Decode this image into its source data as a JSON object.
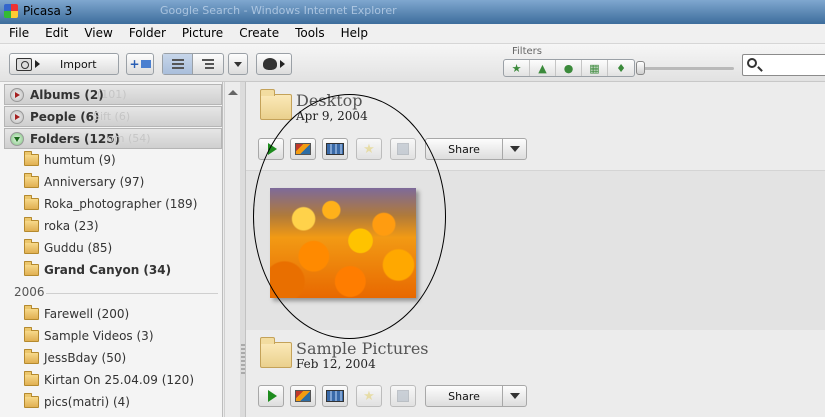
{
  "window": {
    "title": "Picasa 3",
    "background_title": "Google Search - Windows Internet Explorer"
  },
  "menu": [
    "File",
    "Edit",
    "View",
    "Folder",
    "Picture",
    "Create",
    "Tools",
    "Help"
  ],
  "toolbar": {
    "import_label": "Import",
    "filters_label": "Filters",
    "search_placeholder": ""
  },
  "sidebar": {
    "categories": [
      {
        "label": "Albums (2)",
        "ghost": "(101)",
        "expanded": false
      },
      {
        "label": "People (6)",
        "ghost": "Sift (6)",
        "expanded": false
      },
      {
        "label": "Folders (125)",
        "ghost": "om (54)",
        "expanded": true
      }
    ],
    "folders": [
      {
        "label": "humtum (9)",
        "bold": false
      },
      {
        "label": "Anniversary (97)",
        "bold": false
      },
      {
        "label": "Roka_photographer (189)",
        "bold": false
      },
      {
        "label": "roka (23)",
        "bold": false
      },
      {
        "label": "Guddu (85)",
        "bold": false
      },
      {
        "label": "Grand Canyon (34)",
        "bold": true
      }
    ],
    "year": "2006",
    "folders_2006": [
      {
        "label": "Farewell (200)"
      },
      {
        "label": "Sample Videos (3)"
      },
      {
        "label": "JessBday (50)"
      },
      {
        "label": "Kirtan On 25.04.09 (120)"
      },
      {
        "label": "pics(matri) (4)"
      }
    ]
  },
  "sections": [
    {
      "title": "Desktop",
      "date": "Apr 9, 2004",
      "share_label": "Share"
    },
    {
      "title": "Sample Pictures",
      "date": "Feb 12, 2004",
      "share_label": "Share"
    }
  ],
  "filter_icons": [
    "star-filter-icon",
    "upload-filter-icon",
    "faces-filter-icon",
    "movie-filter-icon",
    "geotag-filter-icon"
  ]
}
